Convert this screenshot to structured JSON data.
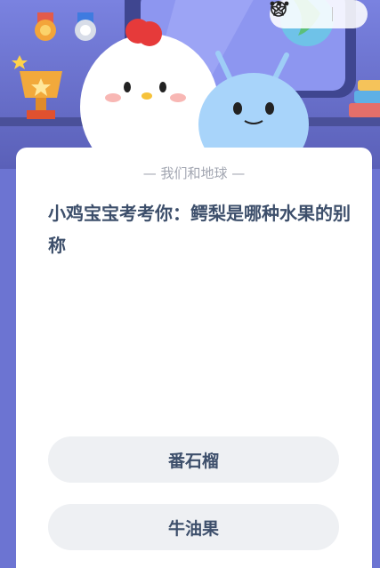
{
  "header": {
    "icons": [
      "star-outline-icon",
      "more-dots-icon",
      "close-circle-icon"
    ]
  },
  "quiz": {
    "subject": "— 我们和地球 —",
    "question": "小鸡宝宝考考你：鳄梨是哪种水果的别称",
    "options": [
      "番石榴",
      "牛油果"
    ]
  },
  "colors": {
    "banner_bg": "#6c74d2",
    "card_bg": "#ffffff",
    "option_bg": "#eef0f3",
    "question_text": "#3d4f6b",
    "subject_text": "#a2a6b1"
  }
}
